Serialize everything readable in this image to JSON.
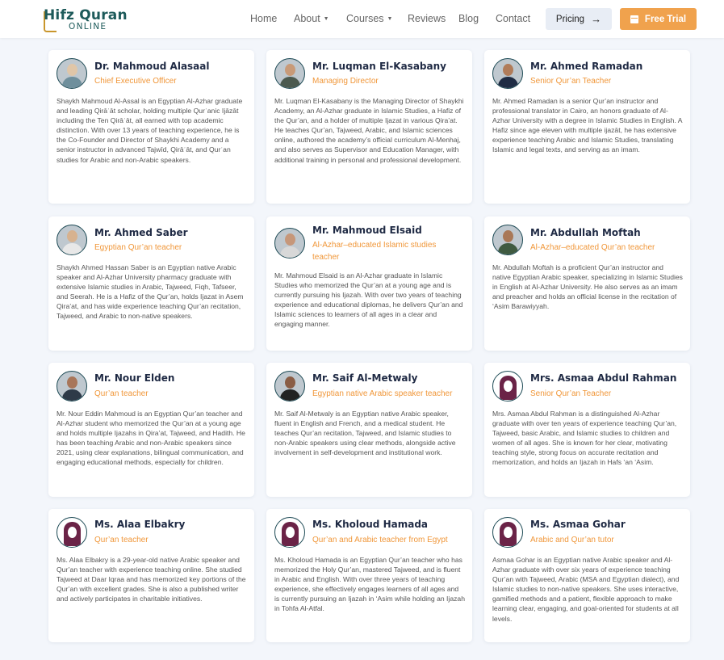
{
  "header": {
    "logo_top": "Hifz Quran",
    "logo_bottom": "ONLINE",
    "nav": [
      {
        "label": "Home"
      },
      {
        "label": "About"
      },
      {
        "label": "Courses"
      },
      {
        "label": "Reviews"
      },
      {
        "label": "Blog"
      },
      {
        "label": "Contact"
      }
    ],
    "pricing_label": "Pricing",
    "trial_label": "Free Trial",
    "accent_color": "#f0a24d"
  },
  "teachers": [
    {
      "name": "Dr. Mahmoud Alasaal",
      "role": "Chief Executive Officer",
      "avatar": "photo",
      "desc": "Shaykh Mahmoud Al-Assal is an Egyptian Al-Azhar graduate and leading Qirāʾāt scholar, holding multiple Qurʾanic Ijāzāt including the Ten Qirāʾāt, all earned with top academic distinction. With over 13 years of teaching experience, he is the Co-Founder and Director of Shaykhi Academy and a senior instructor in advanced Tajwīd, Qirāʾāt, and Qurʾan studies for Arabic and non-Arabic speakers."
    },
    {
      "name": "Mr. Luqman El-Kasabany",
      "role": "Managing Director",
      "avatar": "photo",
      "desc": "Mr. Luqman El-Kasabany is the Managing Director of Shaykhi Academy, an Al-Azhar graduate in Islamic Studies, a Hafiz of the Qur’an, and a holder of multiple Ijazat in various Qira’at. He teaches Qur’an, Tajweed, Arabic, and Islamic sciences online, authored the academy’s official curriculum Al-Menhaj, and also serves as Supervisor and Education Manager, with additional training in personal and professional development."
    },
    {
      "name": "Mr. Ahmed Ramadan",
      "role": "Senior Qur’an Teacher",
      "avatar": "photo",
      "desc": "Mr. Ahmed Ramadan is a senior Qur’an instructor and professional translator in Cairo, an honors graduate of Al-Azhar University with a degree in Islamic Studies in English. A Hafiz since age eleven with multiple ijazāt, he has extensive experience teaching Arabic and Islamic Studies, translating Islamic and legal texts, and serving as an imam."
    },
    {
      "name": "Mr. Ahmed Saber",
      "role": "Egyptian Qur’an teacher",
      "avatar": "photo",
      "desc": "Shaykh Ahmed Hassan Saber is an Egyptian native Arabic speaker and Al-Azhar University pharmacy graduate with extensive Islamic studies in Arabic, Tajweed, Fiqh, Tafseer, and Seerah. He is a Hafiz of the Qur’an, holds Ijazat in Asem Qira’at, and has wide experience teaching Qur’an recitation, Tajweed, and Arabic to non-native speakers."
    },
    {
      "name": "Mr. Mahmoud Elsaid",
      "role": "Al-Azhar–educated Islamic studies teacher",
      "avatar": "photo",
      "desc": "Mr. Mahmoud Elsaid is an Al-Azhar graduate in Islamic Studies who memorized the Qur’an at a young age and is currently pursuing his Ijazah. With over two years of teaching experience and educational diplomas, he delivers Qur’an and Islamic sciences to learners of all ages in a clear and engaging manner."
    },
    {
      "name": "Mr. Abdullah Moftah",
      "role": "Al-Azhar–educated Qur’an teacher",
      "avatar": "photo",
      "desc": "Mr. Abdullah Moftah is a proficient Qur’an instructor and native Egyptian Arabic speaker, specializing in Islamic Studies in English at Al-Azhar University. He also serves as an imam and preacher and holds an official license in the recitation of ‘Asim Barawiyyah."
    },
    {
      "name": "Mr. Nour Elden",
      "role": "Qur’an teacher",
      "avatar": "photo",
      "desc": "Mr. Nour Eddin Mahmoud is an Egyptian Qur’an teacher and Al-Azhar student who memorized the Qur’an at a young age and holds multiple Ijazahs in Qira’at, Tajweed, and Hadith. He has been teaching Arabic and non-Arabic speakers since 2021, using clear explanations, bilingual communication, and engaging educational methods, especially for children."
    },
    {
      "name": "Mr. Saif Al-Metwaly",
      "role": "Egyptian native Arabic speaker teacher",
      "avatar": "photo",
      "desc": "Mr. Saif Al-Metwaly is an Egyptian native Arabic speaker, fluent in English and French, and a medical student. He teaches Qur’an recitation, Tajweed, and Islamic studies to non-Arabic speakers using clear methods, alongside active involvement in self-development and institutional work."
    },
    {
      "name": "Mrs. Asmaa Abdul Rahman",
      "role": "Senior Qur’an Teacher",
      "avatar": "female",
      "desc": "Mrs. Asmaa Abdul Rahman is a distinguished Al-Azhar graduate with over ten years of experience teaching Qur’an, Tajweed, basic Arabic, and Islamic studies to children and women of all ages. She is known for her clear, motivating teaching style, strong focus on accurate recitation and memorization, and holds an Ijazah in Hafs ‘an ‘Asim."
    },
    {
      "name": "Ms. Alaa Elbakry",
      "role": "Qur’an teacher",
      "avatar": "female",
      "desc": "Ms. Alaa Elbakry is a 29-year-old native Arabic speaker and Qur’an teacher with experience teaching online. She studied Tajweed at Daar Iqraa and has memorized key portions of the Qur’an with excellent grades. She is also a published writer and actively participates in charitable initiatives."
    },
    {
      "name": "Ms. Kholoud Hamada",
      "role": "Qur’an and Arabic teacher from Egypt",
      "avatar": "female",
      "desc": "Ms. Kholoud Hamada is an Egyptian Qur’an teacher who has memorized the Holy Qur’an, mastered Tajweed, and is fluent in Arabic and English. With over three years of teaching experience, she effectively engages learners of all ages and is currently pursuing an Ijazah in ‘Asim while holding an Ijazah in Tohfa Al-Atfal."
    },
    {
      "name": "Ms. Asmaa Gohar",
      "role": "Arabic and Qur’an tutor",
      "avatar": "female",
      "desc": "Asmaa Gohar is an Egyptian native Arabic speaker and Al-Azhar graduate with over six years of experience teaching Qur’an with Tajweed, Arabic (MSA and Egyptian dialect), and Islamic studies to non-native speakers. She uses interactive, gamified methods and a patient, flexible approach to make learning clear, engaging, and goal-oriented for students at all levels."
    }
  ]
}
